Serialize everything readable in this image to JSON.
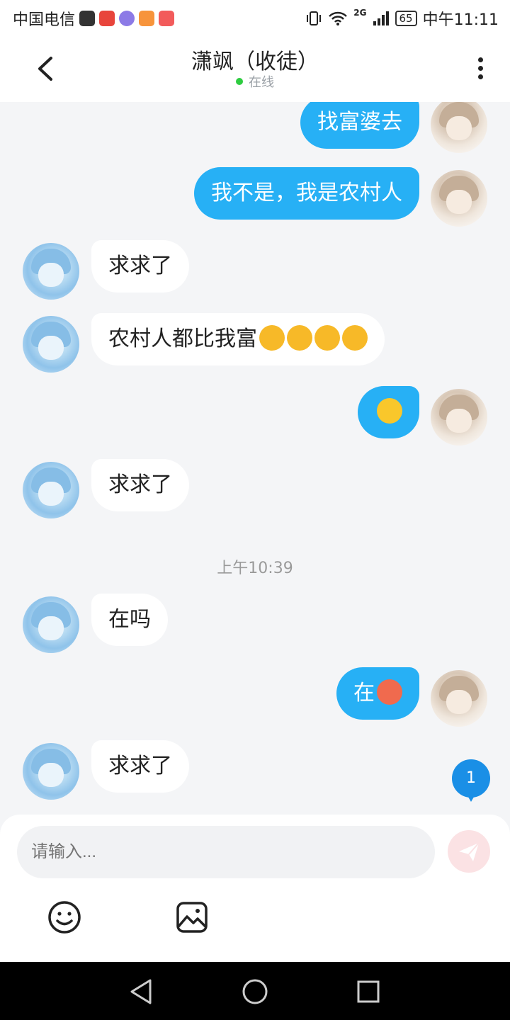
{
  "status_bar": {
    "carrier": "中国电信",
    "network": "2G",
    "battery": "65",
    "time": "中午11:11"
  },
  "header": {
    "title": "潇飒（收徒）",
    "presence": "在线"
  },
  "messages": [
    {
      "side": "out",
      "text": "找富婆去",
      "emojis": []
    },
    {
      "side": "out",
      "text": "我不是，我是农村人",
      "emojis": []
    },
    {
      "side": "in",
      "text": "求求了",
      "emojis": []
    },
    {
      "side": "in",
      "text": "农村人都比我富",
      "emojis": [
        "crying-face",
        "crying-face",
        "crying-face",
        "crying-face"
      ]
    },
    {
      "side": "out",
      "text": "",
      "emojis": [
        "smiling-face"
      ]
    },
    {
      "side": "in",
      "text": "求求了",
      "emojis": []
    },
    {
      "side": "in",
      "text": "在吗",
      "emojis": []
    },
    {
      "side": "out",
      "text": "在",
      "emojis": [
        "angry-face"
      ]
    },
    {
      "side": "in",
      "text": "求求了",
      "emojis": []
    }
  ],
  "timestamp": "上午10:39",
  "unread_badge": "1",
  "composer": {
    "placeholder": "请输入..."
  },
  "colors": {
    "outgoing_bubble": "#27b0f5",
    "incoming_bubble": "#ffffff",
    "badge": "#1a8fe6",
    "online_dot": "#2ecc40"
  },
  "icons": {
    "back": "chevron-left-icon",
    "more": "more-vertical-icon",
    "send": "paper-plane-icon",
    "emoji": "emoji-icon",
    "image": "image-icon"
  }
}
